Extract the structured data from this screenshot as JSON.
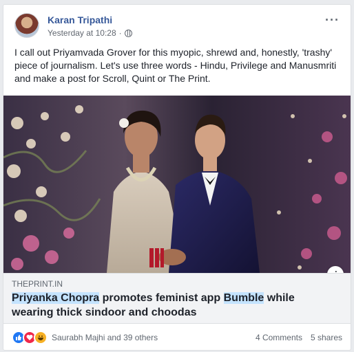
{
  "post": {
    "author": "Karan Tripathi",
    "timestamp": "Yesterday at 10:28",
    "separator": "·",
    "privacy_icon": "globe-icon",
    "text": "I call out Priyamvada Grover for this myopic, shrewd and, honestly, 'trashy' piece of journalism. Let's use three words - Hindu, Privilege and Manusmriti and make a post for Scroll, Quint or The Print.",
    "more_icon": "more-options-icon"
  },
  "link": {
    "domain": "THEPRINT.IN",
    "headline_parts": [
      {
        "text": "Priyanka Chopra",
        "highlight": true
      },
      {
        "text": " promotes feminist app ",
        "highlight": false
      },
      {
        "text": "Bumble",
        "highlight": true
      },
      {
        "text": " while wearing thick sindoor and choodas",
        "highlight": false
      }
    ],
    "info_icon": "i"
  },
  "footer": {
    "reaction_icons": [
      "like-icon",
      "love-icon",
      "haha-icon"
    ],
    "reaction_names": "Saurabh Majhi and 39 others",
    "comments": "4 Comments",
    "shares": "5 shares"
  },
  "colors": {
    "author": "#365899",
    "highlight": "#c4e3fe",
    "like": "#2078f4",
    "love": "#f0284a",
    "haha": "#f7b125"
  }
}
